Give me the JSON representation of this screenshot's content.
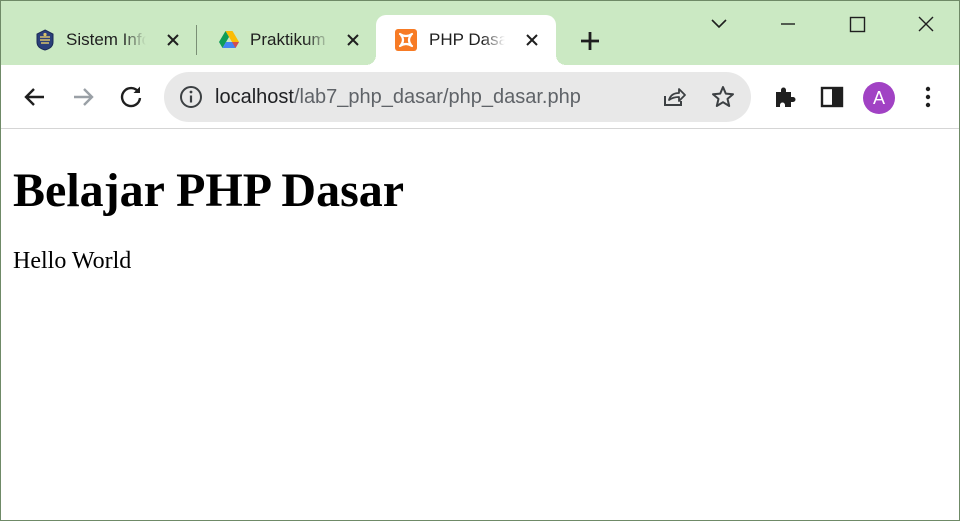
{
  "tabs": [
    {
      "title": "Sistem Informasi",
      "favicon": "university-logo-icon",
      "active": false
    },
    {
      "title": "Praktikum",
      "favicon": "google-drive-icon",
      "active": false
    },
    {
      "title": "PHP Dasar",
      "favicon": "xampp-icon",
      "active": true
    }
  ],
  "toolbar": {
    "url_host": "localhost",
    "url_path": "/lab7_php_dasar/php_dasar.php",
    "avatar_letter": "A",
    "avatar_color": "#a142c4"
  },
  "page": {
    "heading": "Belajar PHP Dasar",
    "paragraph": "Hello World"
  },
  "colors": {
    "tabstrip_bg": "#cbe9c3",
    "omnibox_bg": "#e8e8e8",
    "xampp_orange": "#f77b25"
  }
}
